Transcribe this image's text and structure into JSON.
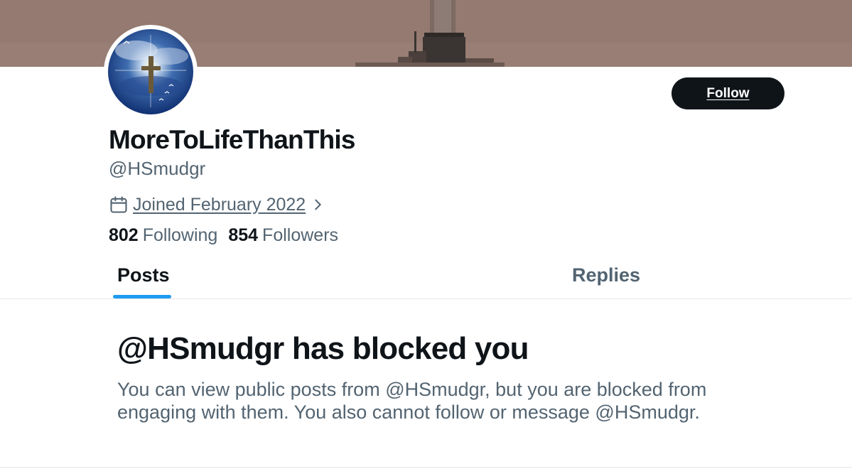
{
  "profile": {
    "display_name": "MoreToLifeThanThis",
    "handle": "@HSmudgr",
    "joined": "Joined February 2022",
    "following_count": "802",
    "following_label": "Following",
    "followers_count": "854",
    "followers_label": "Followers"
  },
  "actions": {
    "follow_label": "Follow"
  },
  "tabs": [
    {
      "label": "Posts",
      "selected": true
    },
    {
      "label": "Replies",
      "selected": false
    }
  ],
  "blocked": {
    "title": "@HSmudgr has blocked you",
    "description": "You can view public posts from @HSmudgr, but you are blocked from engaging with them. You also cannot follow or message @HSmudgr."
  },
  "icons": {
    "joined": "calendar-icon",
    "joined_more": "chevron-right-icon"
  },
  "colors": {
    "text_primary": "#0f1419",
    "text_secondary": "#536471",
    "accent": "#1d9bf0",
    "button_bg": "#0f1419"
  }
}
